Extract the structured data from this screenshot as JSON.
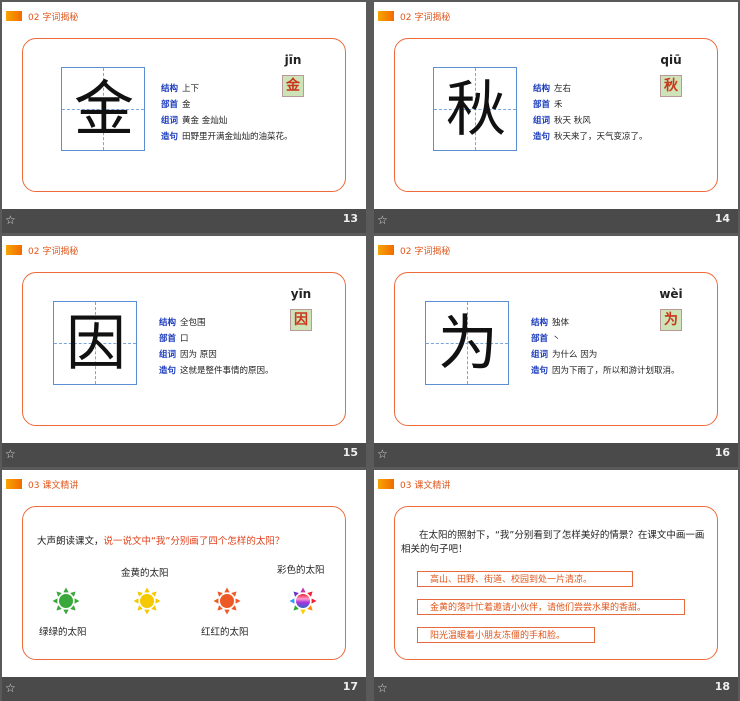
{
  "footer_icon": "☆",
  "slides": [
    {
      "number": "13",
      "section": "02  字词揭秘",
      "char": "金",
      "pinyin": "jīn",
      "rows": [
        {
          "k": "结构",
          "v": "上下"
        },
        {
          "k": "部首",
          "v": "金"
        },
        {
          "k": "组词",
          "v": "黄金  金灿灿"
        },
        {
          "k": "造句",
          "v": "田野里开满金灿灿的油菜花。"
        }
      ]
    },
    {
      "number": "14",
      "section": "02  字词揭秘",
      "char": "秋",
      "pinyin": "qiū",
      "rows": [
        {
          "k": "结构",
          "v": "左右"
        },
        {
          "k": "部首",
          "v": "禾"
        },
        {
          "k": "组词",
          "v": "秋天   秋风"
        },
        {
          "k": "造句",
          "v": "秋天来了，天气变凉了。"
        }
      ]
    },
    {
      "number": "15",
      "section": "02  字词揭秘",
      "char": "因",
      "pinyin": "yīn",
      "rows": [
        {
          "k": "结构",
          "v": "全包围"
        },
        {
          "k": "部首",
          "v": "口"
        },
        {
          "k": "组词",
          "v": "因为    原因"
        },
        {
          "k": "造句",
          "v": "这就是整件事情的原因。"
        }
      ]
    },
    {
      "number": "16",
      "section": "02  字词揭秘",
      "char": "为",
      "pinyin": "wèi",
      "rows": [
        {
          "k": "结构",
          "v": "独体"
        },
        {
          "k": "部首",
          "v": "丶"
        },
        {
          "k": "组词",
          "v": "为什么   因为"
        },
        {
          "k": "造句",
          "v": "因为下雨了，所以和游计划取消。"
        }
      ]
    },
    {
      "number": "17",
      "section": "03  课文精讲",
      "prompt_black": "大声朗读课文，",
      "prompt_red": "说一说文中“我”分别画了四个怎样的太阳？",
      "suns": [
        {
          "label": "绿绿的太阳",
          "color": "#3aa83a",
          "icon": "sun-icon"
        },
        {
          "label": "金黄的太阳",
          "color": "#f5c800",
          "icon": "sun-icon"
        },
        {
          "label": "红红的太阳",
          "color": "#ee5a26",
          "icon": "sun-icon"
        },
        {
          "label": "彩色的太阳",
          "color": "#b04aa8",
          "icon": "sun-icon"
        }
      ]
    },
    {
      "number": "18",
      "section": "03  课文精讲",
      "question": "在太阳的照射下，“我”分别看到了怎样美好的情景？在课文中画一画相关的句子吧！",
      "quotes": [
        "高山、田野、街道、校园到处一片清凉。",
        "金黄的落叶忙着邀请小伙伴，请他们尝尝水果的香甜。",
        "阳光温暖着小朋友冻僵的手和脸。"
      ]
    }
  ]
}
